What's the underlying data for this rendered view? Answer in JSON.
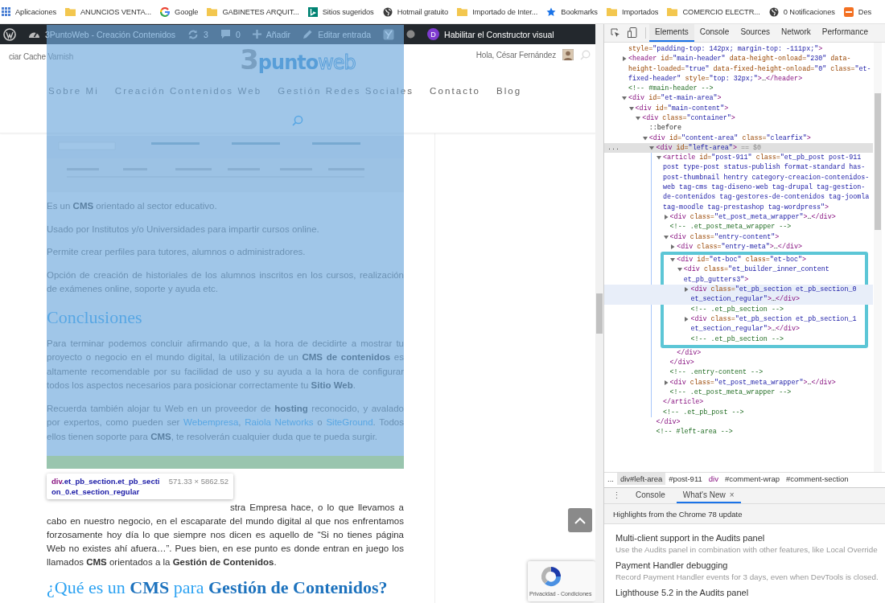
{
  "bookmarks": [
    {
      "kind": "apps",
      "label": "Aplicaciones"
    },
    {
      "kind": "folder",
      "label": "ANUNCIOS VENTA..."
    },
    {
      "kind": "ring",
      "label": "Google"
    },
    {
      "kind": "folder",
      "label": "GABINETES ARQUIT..."
    },
    {
      "kind": "tile",
      "label": "Sitios sugeridos"
    },
    {
      "kind": "globe",
      "label": "Hotmail gratuito"
    },
    {
      "kind": "folder",
      "label": "Importado de Inter..."
    },
    {
      "kind": "star",
      "label": "Bookmarks"
    },
    {
      "kind": "folder",
      "label": "Importados"
    },
    {
      "kind": "folder",
      "label": "COMERCIO ELECTR..."
    },
    {
      "kind": "globe",
      "label": "0 Notificaciones"
    },
    {
      "kind": "badge",
      "label": "Des"
    }
  ],
  "admin_bar": [
    {
      "kind": "logo"
    },
    {
      "kind": "gauge",
      "label": "3PuntoWeb - Creación Contenidos"
    },
    {
      "kind": "refresh",
      "label": "3"
    },
    {
      "kind": "comment",
      "label": "0"
    },
    {
      "kind": "plus",
      "label": "Añadir"
    },
    {
      "kind": "pencil",
      "label": "Editar entrada"
    },
    {
      "kind": "plugin"
    },
    {
      "kind": "dot"
    },
    {
      "kind": "circle",
      "glyph": "D",
      "label": "Habilitar el Constructor visual"
    }
  ],
  "header": {
    "left_text": "ciar Cache Varnish",
    "logo": [
      "3",
      "punto",
      "web"
    ],
    "greeting": "Hola, César Fernández",
    "nav": [
      "Sobre Mi",
      "Creación Contenidos Web",
      "Gestión Redes Sociales",
      "Contacto",
      "Blog"
    ]
  },
  "article": [
    {
      "kind": "picture"
    },
    {
      "kind": "paragraph",
      "text": "Es un **CMS** orientado al sector educativo."
    },
    {
      "kind": "paragraph",
      "text": "Usado por Institutos y/o Universidades para impartir cursos online."
    },
    {
      "kind": "paragraph",
      "text": "Permite crear perfiles para tutores, alumnos o administradores."
    },
    {
      "kind": "paragraph",
      "text": "Opción de creación de historiales de los alumnos inscritos en los cursos, realización de exámenes online, soporte y ayuda etc."
    },
    {
      "kind": "heading",
      "text": "Conclusiones"
    },
    {
      "kind": "paragraph",
      "text": "Para terminar podemos concluir afirmando que, a la hora de decidirte a mostrar tu proyecto o negocio en el mundo digital, la utilización de un **CMS de contenidos** es altamente recomendable por su facilidad de uso y su ayuda a la hora de configurar todos los aspectos necesarios para posicionar correctamente tu **Sitio Web**."
    },
    {
      "kind": "paragraph",
      "parts": [
        {
          "kind": "text",
          "text": "Recuerda también alojar tu Web en un proveedor de **hosting** reconocido, y avalado por expertos, como pueden ser "
        },
        {
          "kind": "link",
          "text": "Webempresa"
        },
        {
          "kind": "text",
          "text": ", "
        },
        {
          "kind": "link",
          "text": "Raiola Networks"
        },
        {
          "kind": "text",
          "text": " o "
        },
        {
          "kind": "link",
          "text": "SiteGround"
        },
        {
          "kind": "text",
          "text": ". Todos ellos tienen soporte para **CMS**, te resolverán cualquier duda que te pueda surgir."
        }
      ]
    }
  ],
  "after": [
    {
      "kind": "paragraph",
      "text": "stra Empresa hace, o lo que llevamos a cabo en nuestro negocio, en el escaparate del mundo digital al que nos enfrentamos forzosamente hoy día lo que siempre nos dicen es aquello de “Si no tienes página Web no existes ahí afuera…”. Pues bien, en ese punto es donde entran en juego los llamados **CMS** orientados a la **Gestión de Contenidos**."
    },
    {
      "kind": "heading",
      "text": "¿Qué es un **CMS** para **Gestión de Contenidos?**"
    }
  ],
  "tooltip": {
    "tag": "div",
    "classes": ".et_pb_section.et_pb_section_0.et_section_regular",
    "size": "571.33 × 5862.52"
  },
  "recaptcha": {
    "text": "Privacidad - Condiciones"
  },
  "devtools": {
    "tabs": [
      {
        "label": "Elements",
        "selected": true
      },
      {
        "label": "Console",
        "selected": false
      },
      {
        "label": "Sources",
        "selected": false
      },
      {
        "label": "Network",
        "selected": false
      },
      {
        "label": "Performance",
        "selected": false
      }
    ],
    "tree": [
      {
        "kind": "text",
        "text": "style=\"padding-top: 142px; margin-top: -111px;\">"
      },
      {
        "kind": "element",
        "open": "<header id=\"main-header\" data-height-onload=\"230\" data-height-loaded=\"true\" data-fixed-height-onload=\"0\" class=\"et-fixed-header\" style=\"top: 32px;\">…</header>",
        "expanded": false,
        "selected": false,
        "hovered": false,
        "boxed": false
      },
      {
        "kind": "comment",
        "text": "<!-- #main-header -->"
      },
      {
        "kind": "element",
        "open": "<div id=\"et-main-area\">",
        "expanded": true,
        "selected": false,
        "hovered": false,
        "boxed": false,
        "children": [
          {
            "kind": "element",
            "open": "<div id=\"main-content\">",
            "expanded": true,
            "selected": false,
            "hovered": false,
            "boxed": false,
            "children": [
              {
                "kind": "element",
                "open": "<div class=\"container\">",
                "expanded": true,
                "selected": false,
                "hovered": false,
                "boxed": false,
                "children": [
                  {
                    "kind": "text",
                    "text": "::before"
                  },
                  {
                    "kind": "element",
                    "open": "<div id=\"content-area\" class=\"clearfix\">",
                    "expanded": true,
                    "selected": false,
                    "hovered": false,
                    "boxed": false,
                    "children": [
                      {
                        "kind": "element",
                        "open": "<div id=\"left-area\">",
                        "suffix": " == $0",
                        "gutter": "...",
                        "expanded": true,
                        "selected": true,
                        "hovered": false,
                        "boxed": false,
                        "close": "</div>",
                        "children": [
                          {
                            "kind": "element",
                            "open": "<article id=\"post-911\" class=\"et_pb_post post-911 post type-post status-publish format-standard has-post-thumbnail hentry category-creacion-contenidos-web tag-cms tag-diseno-web tag-drupal tag-gestion-de-contenidos tag-gestores-de-contenidos tag-joomla tag-moodle tag-prestashop tag-wordpress\">",
                            "expanded": true,
                            "selected": false,
                            "hovered": false,
                            "boxed": false,
                            "close": "</article>",
                            "children": [
                              {
                                "kind": "element",
                                "open": "<div class=\"et_post_meta_wrapper\">…</div>",
                                "expanded": false,
                                "selected": false,
                                "hovered": false,
                                "boxed": false
                              },
                              {
                                "kind": "comment",
                                "text": "<!-- .et_post_meta_wrapper -->"
                              },
                              {
                                "kind": "element",
                                "open": "<div class=\"entry-content\">",
                                "expanded": true,
                                "selected": false,
                                "hovered": false,
                                "boxed": false,
                                "close": "</div>",
                                "children": [
                                  {
                                    "kind": "element",
                                    "open": "<div class=\"entry-meta\">…</div>",
                                    "expanded": false,
                                    "selected": false,
                                    "hovered": false,
                                    "boxed": false
                                  },
                                  {
                                    "kind": "element",
                                    "open": "<div id=\"et-boc\" class=\"et-boc\">",
                                    "expanded": true,
                                    "selected": false,
                                    "hovered": false,
                                    "boxed": true,
                                    "close": "</div>",
                                    "children": [
                                      {
                                        "kind": "element",
                                        "open": "<div class=\"et_builder_inner_content et_pb_gutters3\">",
                                        "expanded": true,
                                        "selected": false,
                                        "hovered": false,
                                        "boxed": false,
                                        "children": [
                                          {
                                            "kind": "element",
                                            "open": "<div class=\"et_pb_section et_pb_section_0 et_section_regular\">…</div>",
                                            "expanded": false,
                                            "selected": false,
                                            "hovered": true,
                                            "boxed": false
                                          },
                                          {
                                            "kind": "comment",
                                            "text": "<!-- .et_pb_section -->"
                                          },
                                          {
                                            "kind": "element",
                                            "open": "<div class=\"et_pb_section et_pb_section_1 et_section_regular\">…</div>",
                                            "expanded": false,
                                            "selected": false,
                                            "hovered": false,
                                            "boxed": false
                                          },
                                          {
                                            "kind": "comment",
                                            "text": "<!-- .et_pb_section -->"
                                          }
                                        ]
                                      }
                                    ]
                                  }
                                ]
                              },
                              {
                                "kind": "comment",
                                "text": "<!-- .entry-content -->"
                              },
                              {
                                "kind": "element",
                                "open": "<div class=\"et_post_meta_wrapper\">…</div>",
                                "expanded": false,
                                "selected": false,
                                "hovered": false,
                                "boxed": false
                              },
                              {
                                "kind": "comment",
                                "text": "<!-- .et_post_meta_wrapper -->"
                              }
                            ]
                          },
                          {
                            "kind": "comment",
                            "text": "<!-- .et_pb_post -->"
                          }
                        ]
                      },
                      {
                        "kind": "comment",
                        "text": "<!-- #left-area -->"
                      }
                    ]
                  }
                ]
              }
            ]
          }
        ]
      }
    ],
    "breadcrumbs": [
      {
        "kind": "more",
        "label": "...",
        "selected": false
      },
      {
        "kind": "node",
        "label": "div#left-area",
        "selected": true
      },
      {
        "kind": "node",
        "label": "#post-911",
        "selected": false
      },
      {
        "kind": "tag",
        "label": "div",
        "selected": false
      },
      {
        "kind": "node",
        "label": "#comment-wrap",
        "selected": false
      },
      {
        "kind": "node",
        "label": "#comment-section",
        "selected": false
      }
    ],
    "drawer": {
      "menu": "⋮",
      "tabs": [
        {
          "label": "Console",
          "selected": false
        },
        {
          "label": "What's New",
          "selected": true,
          "close": "×"
        }
      ],
      "banner": "Highlights from the Chrome 78 update",
      "items": [
        {
          "title": "Multi-client support in the Audits panel",
          "description": "Use the Audits panel in combination with other features, like Local Override"
        },
        {
          "title": "Payment Handler debugging",
          "description": "Record Payment Handler events for 3 days, even when DevTools is closed."
        },
        {
          "title": "Lighthouse 5.2 in the Audits panel"
        }
      ]
    }
  }
}
